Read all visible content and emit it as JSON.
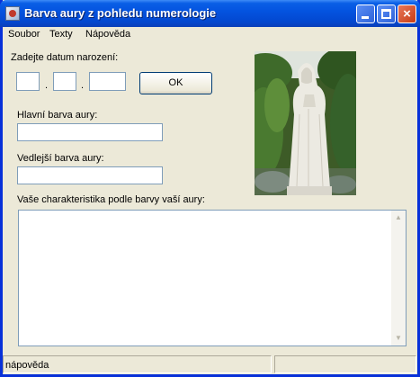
{
  "window": {
    "title": "Barva aury z pohledu numerologie",
    "icon": "app-icon",
    "controls": {
      "minimize": "minimize-icon",
      "maximize": "maximize-icon",
      "close": "×"
    }
  },
  "menu": {
    "items": [
      {
        "label": "Soubor"
      },
      {
        "label": "Texty"
      },
      {
        "label": "Nápověda"
      }
    ]
  },
  "form": {
    "birthdate_label": "Zadejte datum narození:",
    "day_value": "",
    "month_value": "",
    "year_value": "",
    "separator1": ".",
    "separator2": ".",
    "ok_label": "OK",
    "main_color_label": "Hlavní barva aury:",
    "main_color_value": "",
    "secondary_color_label": "Vedlejší barva aury:",
    "secondary_color_value": "",
    "characteristics_label": "Vaše charakteristika podle barvy vaší aury:",
    "characteristics_value": ""
  },
  "image": {
    "subject": "white statue of the Virgin Mary among green trees"
  },
  "statusbar": {
    "text": "nápověda",
    "panel2": ""
  },
  "colors": {
    "titlebar": "#0454e0",
    "window_bg": "#ece9d8",
    "input_border": "#7f9db9"
  }
}
